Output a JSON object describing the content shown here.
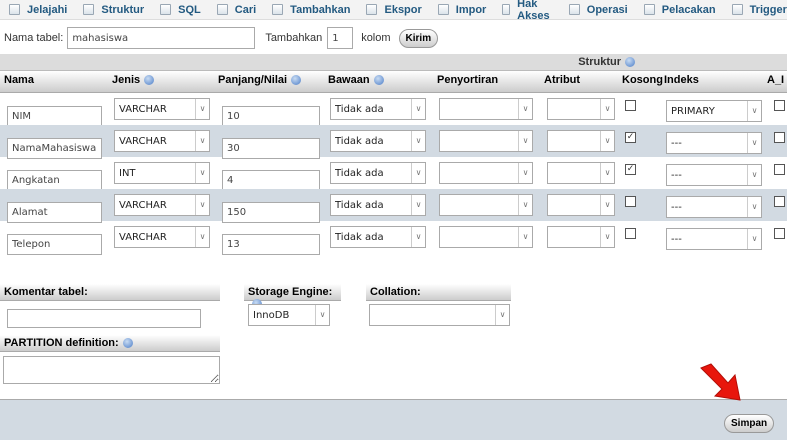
{
  "tabs": [
    {
      "label": "Jelajahi",
      "icon": "table-icon"
    },
    {
      "label": "Struktur",
      "icon": "structure-icon"
    },
    {
      "label": "SQL",
      "icon": "sql-icon"
    },
    {
      "label": "Cari",
      "icon": "search-icon"
    },
    {
      "label": "Tambahkan",
      "icon": "insert-icon"
    },
    {
      "label": "Ekspor",
      "icon": "export-icon"
    },
    {
      "label": "Impor",
      "icon": "import-icon"
    },
    {
      "label": "Hak Akses",
      "icon": "privileges-icon"
    },
    {
      "label": "Operasi",
      "icon": "operations-icon"
    },
    {
      "label": "Pelacakan",
      "icon": "tracking-icon"
    },
    {
      "label": "Trigger",
      "icon": "trigger-icon"
    }
  ],
  "table_name": {
    "label": "Nama tabel:",
    "value": "mahasiswa"
  },
  "add": {
    "label": "Tambahkan",
    "count": "1",
    "unit": "kolom",
    "button": "Kirim"
  },
  "struktur_label": "Struktur",
  "headers": {
    "nama": "Nama",
    "jenis": "Jenis",
    "panjang": "Panjang/Nilai",
    "bawaan": "Bawaan",
    "penyortiran": "Penyortiran",
    "atribut": "Atribut",
    "kosong": "Kosong",
    "indeks": "Indeks",
    "ai": "A_I"
  },
  "columns": [
    {
      "name": "NIM",
      "type": "VARCHAR",
      "length": "10",
      "default": "Tidak ada",
      "collation": "",
      "attribute": "",
      "null": false,
      "index": "PRIMARY",
      "ai": false
    },
    {
      "name": "NamaMahasiswa",
      "type": "VARCHAR",
      "length": "30",
      "default": "Tidak ada",
      "collation": "",
      "attribute": "",
      "null": true,
      "index": "---",
      "ai": false
    },
    {
      "name": "Angkatan",
      "type": "INT",
      "length": "4",
      "default": "Tidak ada",
      "collation": "",
      "attribute": "",
      "null": true,
      "index": "---",
      "ai": false
    },
    {
      "name": "Alamat",
      "type": "VARCHAR",
      "length": "150",
      "default": "Tidak ada",
      "collation": "",
      "attribute": "",
      "null": false,
      "index": "---",
      "ai": false
    },
    {
      "name": "Telepon",
      "type": "VARCHAR",
      "length": "13",
      "default": "Tidak ada",
      "collation": "",
      "attribute": "",
      "null": false,
      "index": "---",
      "ai": false
    }
  ],
  "table_comment": {
    "label": "Komentar tabel:",
    "value": ""
  },
  "storage_engine": {
    "label": "Storage Engine:",
    "value": "InnoDB"
  },
  "collation": {
    "label": "Collation:",
    "value": ""
  },
  "partition": {
    "label": "PARTITION definition:",
    "value": ""
  },
  "save_button": "Simpan",
  "colors": {
    "tab_text": "#235a81",
    "alt_row": "#d2dae2",
    "arrow": "#e8160c"
  }
}
